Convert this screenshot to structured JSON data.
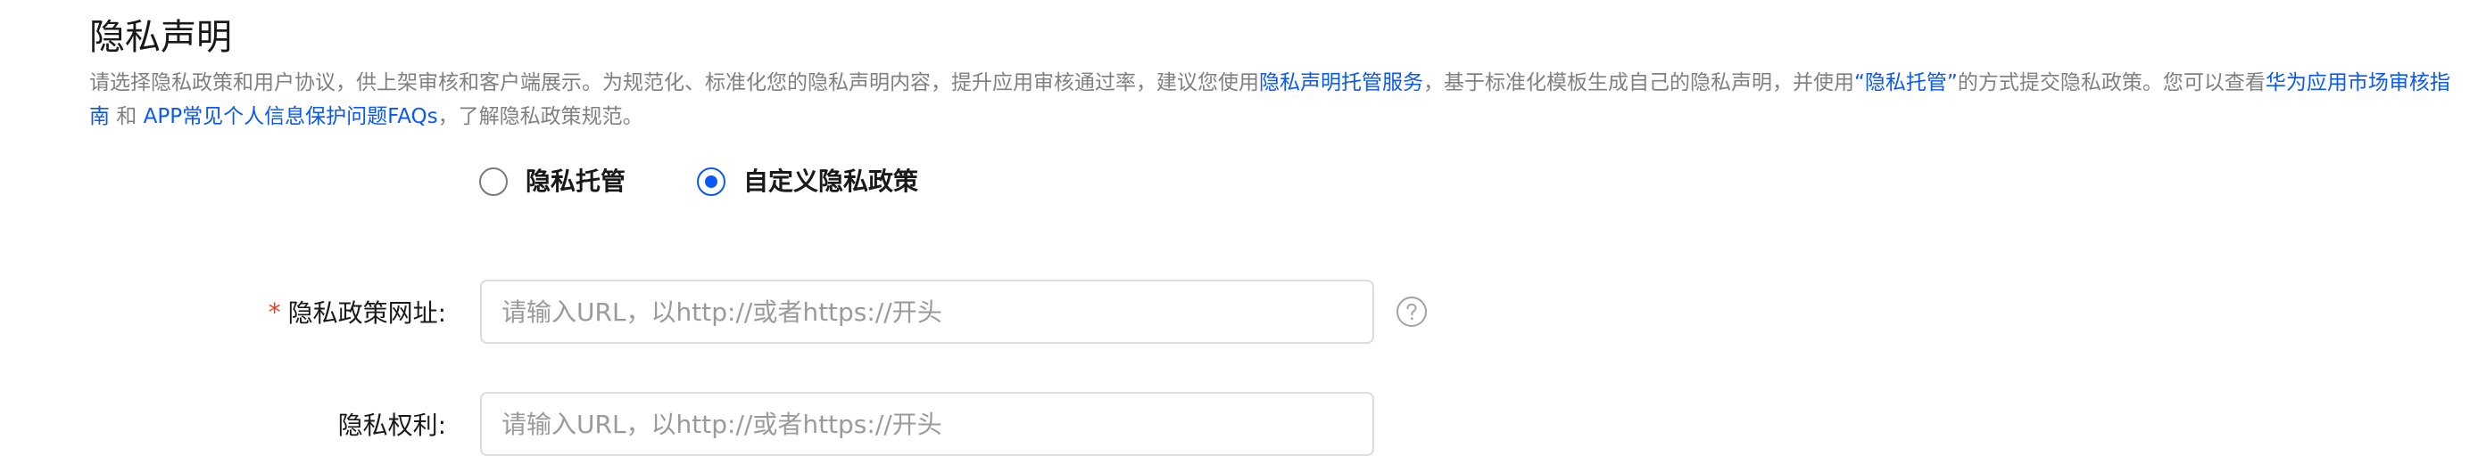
{
  "section": {
    "title": "隐私声明",
    "description": {
      "part1": "请选择隐私政策和用户协议，供上架审核和客户端展示。为规范化、标准化您的隐私声明内容，提升应用审核通过率，建议您使用",
      "link1": "隐私声明托管服务",
      "part2": "，基于标准化模板生成自己的隐私声明，并使用",
      "link2": "“隐私托管”",
      "part3": "的方式提交隐私政策。您可以查看",
      "link3": "华为应用市场审核指南",
      "part4": " 和 ",
      "link4": "APP常见个人信息保护问题FAQs",
      "part5": "，了解隐私政策规范。"
    }
  },
  "privacy_mode": {
    "options": [
      {
        "label": "隐私托管",
        "checked": false
      },
      {
        "label": "自定义隐私政策",
        "checked": true
      }
    ]
  },
  "form": {
    "policy_url": {
      "required_mark": "*",
      "label": "隐私政策网址:",
      "value": "",
      "placeholder": "请输入URL，以http://或者https://开头",
      "help_icon": "question-circle-icon"
    },
    "privacy_rights": {
      "label": "隐私权利:",
      "value": "",
      "placeholder": "请输入URL，以http://或者https://开头"
    }
  },
  "colors": {
    "accent": "#0a59f7",
    "required": "#e84026",
    "muted_text": "#808080",
    "border": "#dcdcdc"
  }
}
